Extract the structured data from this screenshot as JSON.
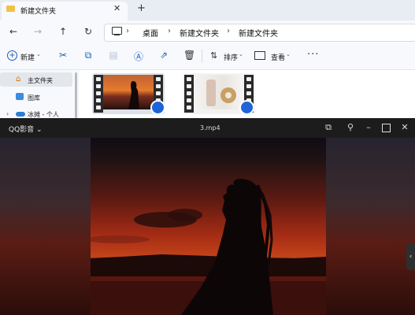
{
  "explorer": {
    "tab_title": "新建文件夹",
    "tab_close": "✕",
    "new_tab": "+",
    "nav": {
      "back": "←",
      "forward": "→",
      "up": "↑",
      "refresh": "↻"
    },
    "breadcrumb": [
      "桌面",
      "新建文件夹",
      "新建文件夹"
    ],
    "breadcrumb_sep": "›",
    "toolbar": {
      "new_label": "新建",
      "sort_label": "排序",
      "view_label": "查看",
      "more": "···"
    },
    "sidebar": {
      "items": [
        {
          "label": "主文件夹",
          "icon": "home-icon"
        },
        {
          "label": "图库",
          "icon": "gallery-icon"
        },
        {
          "label": "冰摊 - 个人",
          "icon": "onedrive-icon"
        }
      ]
    },
    "files": [
      {
        "type": "video",
        "icon": "qq-player-badge-icon"
      },
      {
        "type": "video",
        "icon": "qq-player-badge-icon"
      }
    ]
  },
  "player": {
    "app_name": "QQ影音",
    "file_name": "3.mp4",
    "buttons": [
      "pip-icon",
      "pin-icon",
      "minimize-icon",
      "maximize-icon",
      "close-icon"
    ]
  },
  "colors": {
    "accent": "#1f5fb8",
    "player_bg": "#151515",
    "sunset": "#c2431a"
  }
}
